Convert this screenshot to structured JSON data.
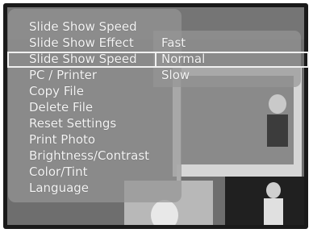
{
  "menu": {
    "title": "Slide Show Speed",
    "items": [
      "Slide Show Effect",
      "Slide Show Speed",
      "PC / Printer",
      "Copy File",
      "Delete File",
      "Reset Settings",
      "Print Photo",
      "Brightness/Contrast",
      "Color/Tint",
      "Language"
    ],
    "selected_index": 1
  },
  "submenu": {
    "options": [
      "Fast",
      "Normal",
      "Slow"
    ],
    "selected_index": 1
  }
}
